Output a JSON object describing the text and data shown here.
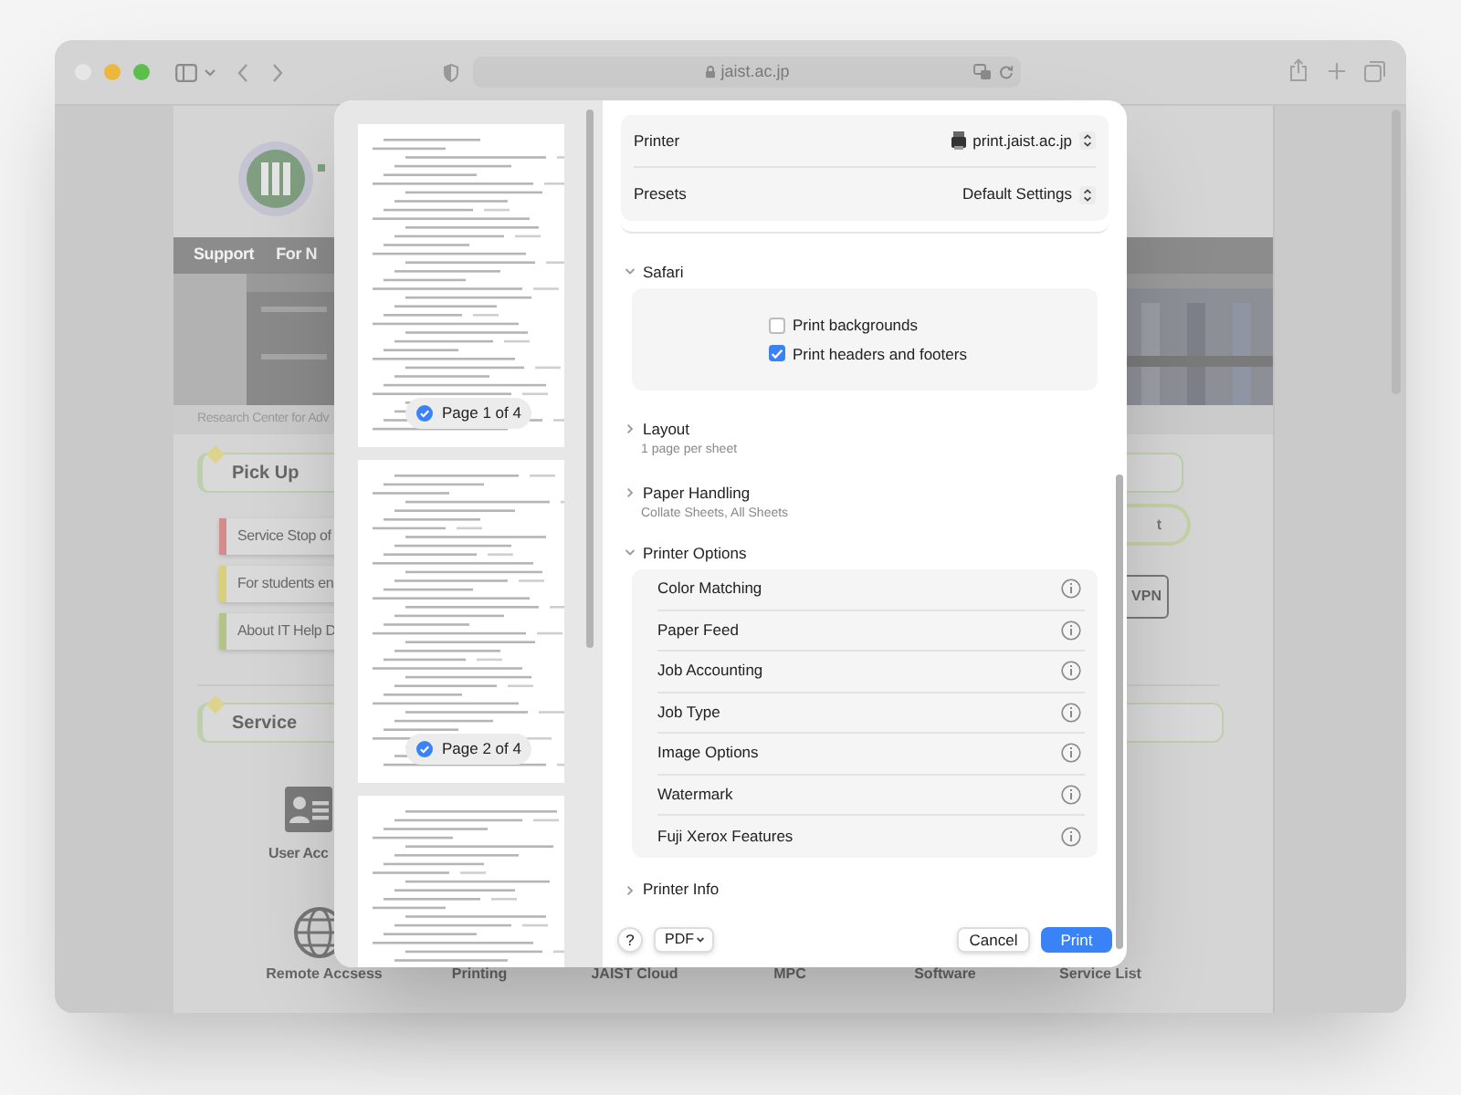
{
  "browser": {
    "address": "jaist.ac.jp"
  },
  "website": {
    "nav": [
      "Support",
      "For N"
    ],
    "caption": "Research Center for Adv",
    "pick_up": {
      "title": "Pick Up",
      "items": [
        {
          "text": "Service Stop of",
          "color": "#d48b8b"
        },
        {
          "text": "For students en",
          "color": "#d9cf7c"
        },
        {
          "text": "About IT Help D",
          "color": "#b3c489"
        }
      ]
    },
    "side_buttons": [
      {
        "kind": "pill",
        "text": "t"
      },
      {
        "kind": "outlined",
        "text": "VPN"
      }
    ],
    "service": {
      "title": "Service",
      "tile": "User Acc",
      "links": [
        "Remote Accsess",
        "Printing",
        "JAIST Cloud",
        "MPC",
        "Software",
        "Service List"
      ]
    }
  },
  "print_dialog": {
    "pages": [
      {
        "kind": "full",
        "label": "Page 1 of 4",
        "selected": true
      },
      {
        "kind": "full",
        "label": "Page 2 of 4",
        "selected": true
      },
      {
        "kind": "partial"
      }
    ],
    "printer": {
      "label": "Printer",
      "value": "print.jaist.ac.jp"
    },
    "presets": {
      "label": "Presets",
      "value": "Default Settings"
    },
    "sections": [
      {
        "title": "Safari",
        "expanded": true,
        "checkboxes": [
          {
            "label": "Print backgrounds",
            "checked": false
          },
          {
            "label": "Print headers and footers",
            "checked": true
          }
        ]
      },
      {
        "title": "Layout",
        "expanded": false,
        "summary": "1 page per sheet"
      },
      {
        "title": "Paper Handling",
        "expanded": false,
        "summary": "Collate Sheets, All Sheets"
      },
      {
        "title": "Printer Options",
        "expanded": true,
        "options": [
          "Color Matching",
          "Paper Feed",
          "Job Accounting",
          "Job Type",
          "Image Options",
          "Watermark",
          "Fuji Xerox Features"
        ]
      },
      {
        "title": "Printer Info",
        "expanded": false
      }
    ],
    "help": "?",
    "format": "PDF",
    "cancel": "Cancel",
    "print": "Print"
  }
}
